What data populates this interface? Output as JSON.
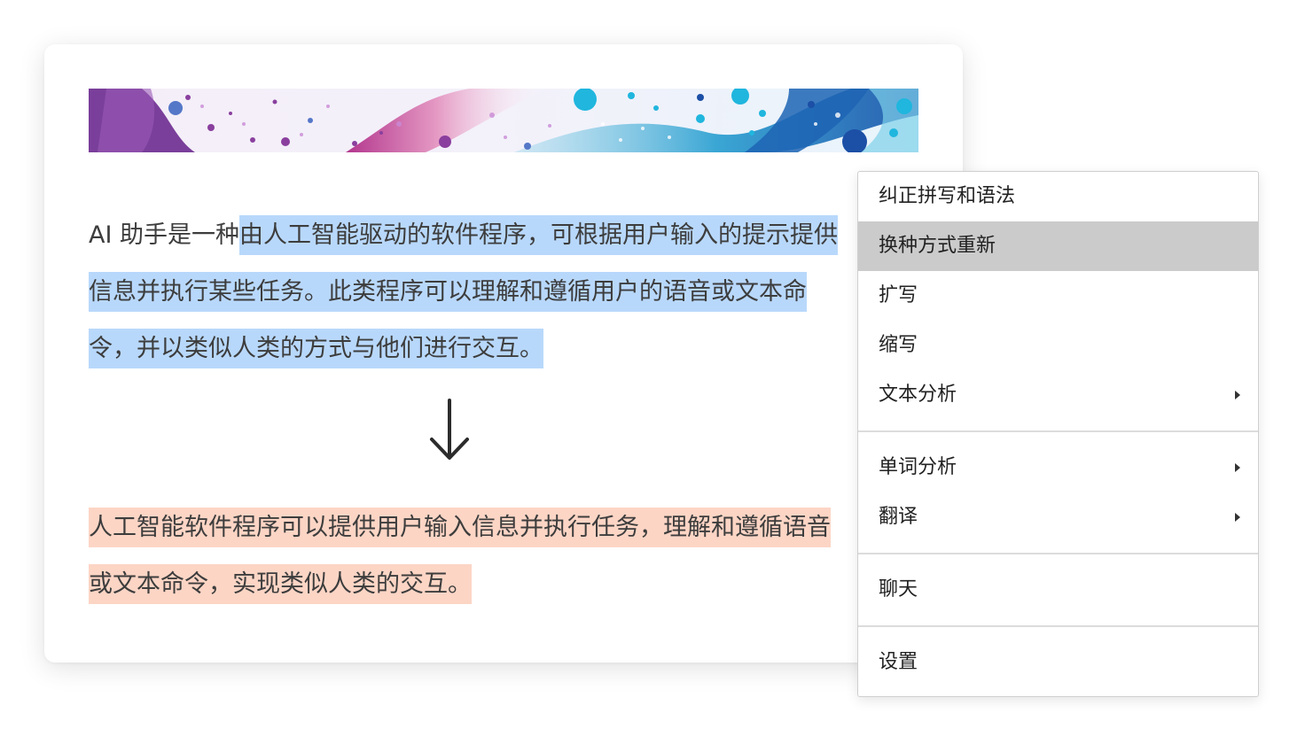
{
  "document": {
    "original": {
      "lead": " AI 助手是一种",
      "selected": "由人工智能驱动的软件程序，可根据用户输入的提示提供信息并执行某些任务。此类程序可以理解和遵循用户的语音或文本命令，并以类似人类的方式与他们进行交互。"
    },
    "result": {
      "text": "人工智能软件程序可以提供用户输入信息并执行任务，理解和遵循语音或文本命令，实现类似人类的交互。"
    }
  },
  "context_menu": {
    "items": [
      {
        "label": "纠正拼写和语法",
        "active": false,
        "submenu": false
      },
      {
        "label": "换种方式重新",
        "active": true,
        "submenu": false
      },
      {
        "label": "扩写",
        "active": false,
        "submenu": false
      },
      {
        "label": "缩写",
        "active": false,
        "submenu": false
      },
      {
        "label": "文本分析",
        "active": false,
        "submenu": true
      },
      {
        "label": "单词分析",
        "active": false,
        "submenu": true
      },
      {
        "label": "翻译",
        "active": false,
        "submenu": true
      },
      {
        "label": "聊天",
        "active": false,
        "submenu": false
      },
      {
        "label": "设置",
        "active": false,
        "submenu": false
      }
    ]
  },
  "icons": {
    "transform_arrow": "arrow-down-icon",
    "submenu_indicator": "chevron-right-icon"
  },
  "colors": {
    "selection_highlight": "#b8d8fb",
    "result_highlight": "#fcd5c5",
    "menu_active": "#cbcbcb"
  }
}
